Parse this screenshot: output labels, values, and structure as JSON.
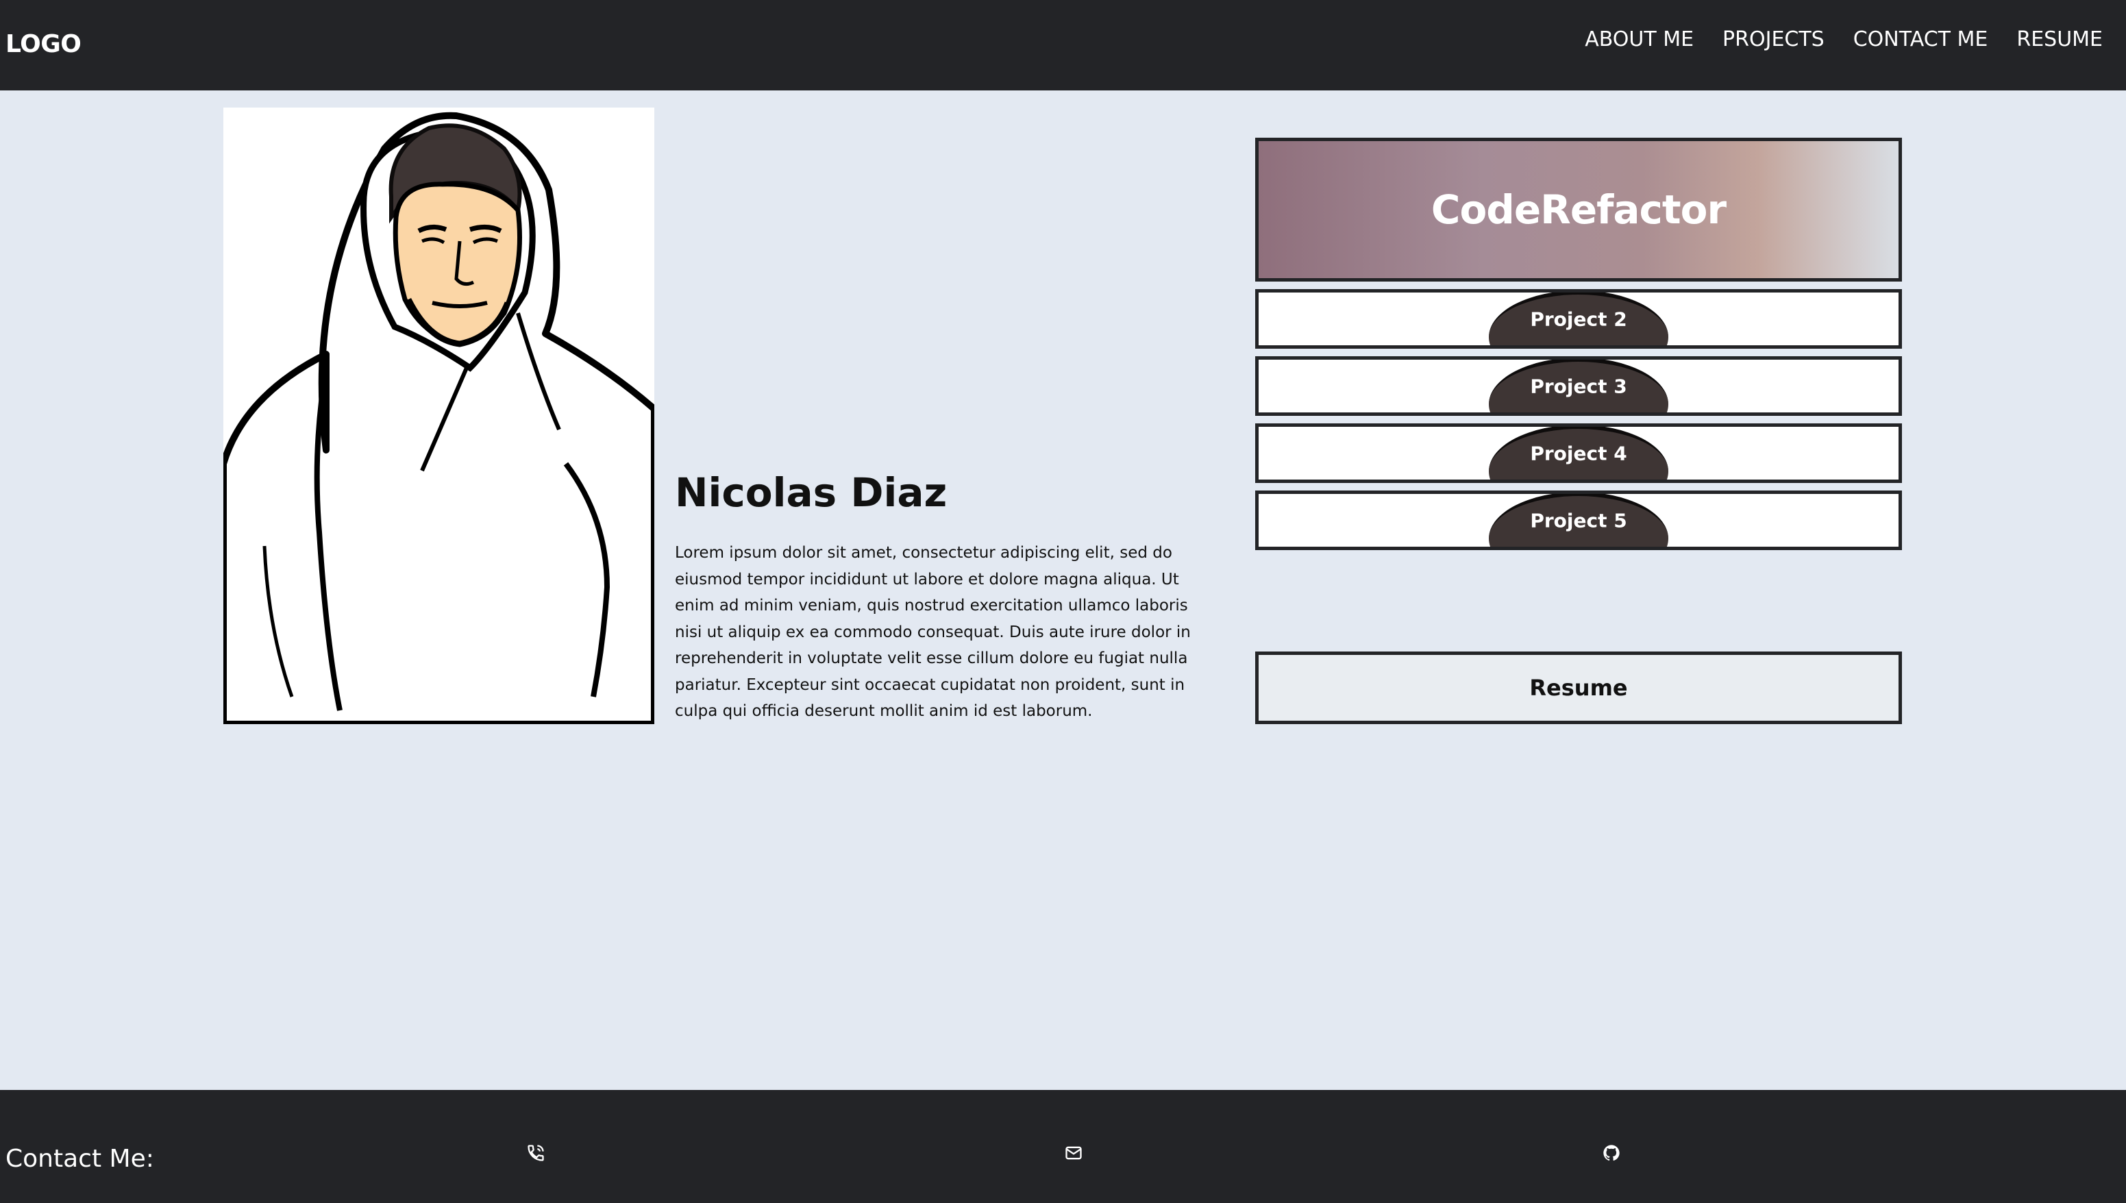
{
  "header": {
    "logo": "LOGO",
    "nav": [
      "ABOUT ME",
      "PROJECTS",
      "CONTACT ME",
      "RESUME"
    ]
  },
  "profile": {
    "name": "Nicolas Diaz",
    "bio": "Lorem ipsum dolor sit amet, consectetur adipiscing elit, sed do eiusmod tempor incididunt ut labore et dolore magna aliqua. Ut enim ad minim veniam, quis nostrud exercitation ullamco laboris nisi ut aliquip ex ea commodo consequat. Duis aute irure dolor in reprehenderit in voluptate velit esse cillum dolore eu fugiat nulla pariatur. Excepteur sint occaecat cupidatat non proident, sunt in culpa qui officia deserunt mollit anim id est laborum."
  },
  "projects": {
    "featured": "CodeRefactor",
    "items": [
      "Project 2",
      "Project 3",
      "Project 4",
      "Project 5"
    ]
  },
  "resume": {
    "label": "Resume"
  },
  "footer": {
    "contact_label": "Contact Me:",
    "icons": [
      "phone-icon",
      "email-icon",
      "github-icon"
    ]
  },
  "colors": {
    "header_bg": "#232427",
    "page_bg": "#e3e9f2",
    "skin": "#fbd6a6",
    "hair": "#3e3534"
  }
}
